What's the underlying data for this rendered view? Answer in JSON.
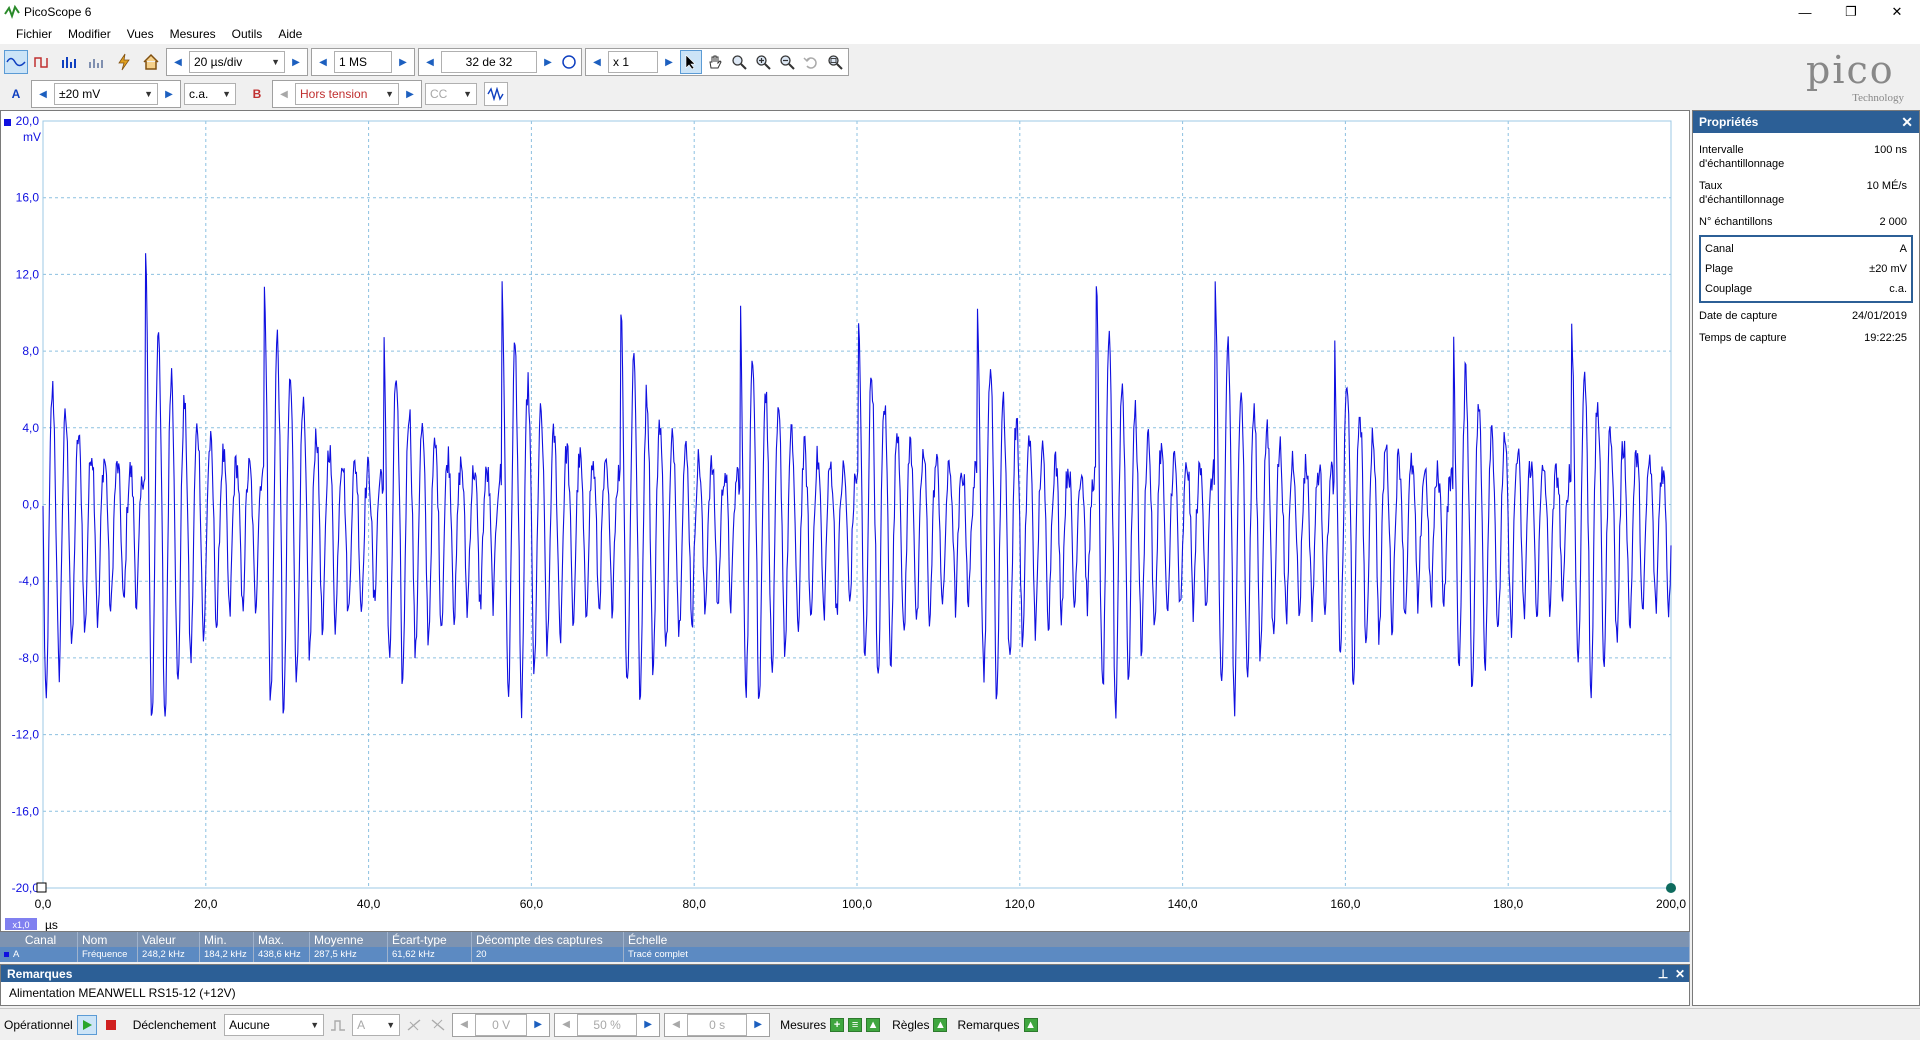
{
  "window": {
    "title": "PicoScope 6",
    "minimize": "—",
    "maximize": "❐",
    "close": "✕"
  },
  "menu": [
    "Fichier",
    "Modifier",
    "Vues",
    "Mesures",
    "Outils",
    "Aide"
  ],
  "toolbar": {
    "timebase": "20 µs/div",
    "samples": "1 MS",
    "buffer": "32 de 32",
    "zoom": "x 1"
  },
  "channel_bar": {
    "channel_a_label": "A",
    "range": "±20 mV",
    "coupling": "c.a.",
    "channel_b_label": "B",
    "channel_b_range": "Hors tension",
    "channel_b_coupling": "CC"
  },
  "logo": {
    "word": "pico",
    "sub": "Technology"
  },
  "scope": {
    "unit_y": "mV",
    "unit_x": "µs",
    "x_scale_badge": "x1,0",
    "y_ticks": [
      "20,0",
      "16,0",
      "12,0",
      "8,0",
      "4,0",
      "0,0",
      "-4,0",
      "-8,0",
      "-12,0",
      "-16,0",
      "-20,0"
    ],
    "x_ticks": [
      "0,0",
      "20,0",
      "40,0",
      "60,0",
      "80,0",
      "100,0",
      "120,0",
      "140,0",
      "160,0",
      "180,0",
      "200,0"
    ],
    "trace_color": "#1010e0",
    "grid_color": "#8cc0e0"
  },
  "chart_data": {
    "type": "line",
    "xlabel": "µs",
    "ylabel": "mV",
    "xlim": [
      0,
      200
    ],
    "ylim": [
      -20,
      20
    ],
    "grid": true,
    "series": [
      {
        "name": "A",
        "approx_period_us": 14.6,
        "peaks_mV": [
          14,
          16.5,
          15.2,
          11.5,
          14.5,
          13.5,
          14,
          12,
          13,
          14.5,
          15,
          11,
          12
        ]
      }
    ]
  },
  "measurements": {
    "headers": [
      "Canal",
      "Nom",
      "Valeur",
      "Min.",
      "Max.",
      "Moyenne",
      "Écart-type",
      "Décompte des captures",
      "Échelle"
    ],
    "rows": [
      [
        "A",
        "Fréquence",
        "248,2 kHz",
        "184,2 kHz",
        "438,6 kHz",
        "287,5 kHz",
        "61,62 kHz",
        "20",
        "Tracé complet"
      ]
    ]
  },
  "remarks": {
    "title": "Remarques",
    "text": "Alimentation MEANWELL RS15-12 (+12V)"
  },
  "properties": {
    "title": "Propriétés",
    "top": [
      {
        "k": "Intervalle d'échantillonnage",
        "v": "100 ns"
      },
      {
        "k": "Taux d'échantillonnage",
        "v": "10 MÉ/s"
      },
      {
        "k": "N° échantillons",
        "v": "2 000"
      }
    ],
    "channel": [
      {
        "k": "Canal",
        "v": "A"
      },
      {
        "k": "Plage",
        "v": "±20 mV"
      },
      {
        "k": "Couplage",
        "v": "c.a."
      }
    ],
    "bottom": [
      {
        "k": "Date de capture",
        "v": "24/01/2019"
      },
      {
        "k": "Temps de capture",
        "v": "19:22:25"
      }
    ]
  },
  "status": {
    "mode": "Opérationnel",
    "trigger_label": "Déclenchement",
    "trigger_value": "Aucune",
    "trigger_channel": "A",
    "threshold": "0 V",
    "pretrigger": "50 %",
    "delay": "0 s",
    "measures": "Mesures",
    "rulers": "Règles",
    "notes": "Remarques"
  }
}
